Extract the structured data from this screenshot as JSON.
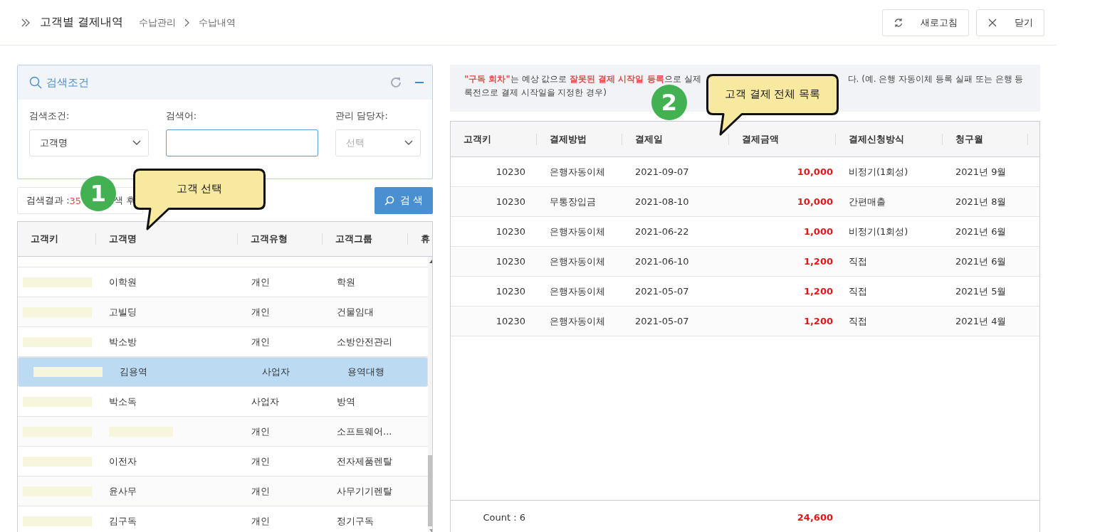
{
  "header": {
    "title": "고객별 결제내역",
    "breadcrumb": [
      "수납관리",
      "수납내역"
    ],
    "buttons": [
      {
        "label": "새로고침",
        "kind": "refresh"
      },
      {
        "label": "닫기",
        "kind": "close"
      }
    ]
  },
  "search_panel": {
    "title": "검색조건",
    "expanded": true,
    "fields": [
      {
        "label": "검색조건:",
        "kind": "select",
        "value": "고객명"
      },
      {
        "label": "검색어:",
        "kind": "input",
        "focused": true
      },
      {
        "label": "관리 담당자:",
        "kind": "select",
        "placeholder": "선택"
      }
    ]
  },
  "search_result": {
    "label": "검색결과 :",
    "count": "35",
    "tail": "색 후"
  },
  "search_button": "검 색",
  "customers": {
    "columns": [
      "고객키",
      "고객명",
      "고객유형",
      "고객그룹",
      "휴"
    ],
    "rows": [
      {
        "key_redacted": true,
        "name": "이학원",
        "type": "개인",
        "group": "학원",
        "selected": false
      },
      {
        "key_redacted": true,
        "name": "고빌딩",
        "type": "개인",
        "group": "건물임대",
        "selected": false
      },
      {
        "key_redacted": true,
        "name": "박소방",
        "type": "개인",
        "group": "소방안전관리",
        "selected": false
      },
      {
        "key_redacted": true,
        "name": "김용역",
        "type": "사업자",
        "group": "용역대행",
        "selected": true
      },
      {
        "key_redacted": true,
        "name": "박소독",
        "type": "사업자",
        "group": "방역",
        "selected": false
      },
      {
        "key_redacted": true,
        "name_redacted": true,
        "type": "개인",
        "group": "소프트웨어...",
        "selected": false
      },
      {
        "key_redacted": true,
        "name": "이전자",
        "type": "개인",
        "group": "전자제품렌탈",
        "selected": false
      },
      {
        "key_redacted": true,
        "name": "윤사무",
        "type": "개인",
        "group": "사무기기렌탈",
        "selected": false
      },
      {
        "key_redacted": true,
        "name": "김구독",
        "type": "개인",
        "group": "정기구독",
        "selected": false
      }
    ]
  },
  "notice": {
    "line1_start": "**\"구독 회차\"**는 예상 값으로 **잘못된 결제 시작일 등록**으로 실제",
    "line1_end": "다. (예. 은행 자동이체 등록 실패 또는 은행 등",
    "line2": "록전으로 결제 시작일을 지정한 경우)"
  },
  "payments": {
    "columns": [
      "고객키",
      "결제방법",
      "결제일",
      "결제금액",
      "결제신청방식",
      "청구월"
    ],
    "rows": [
      [
        "10230",
        "은행자동이체",
        "2021-09-07",
        "10,000",
        "비정기(1회성)",
        "2021년 9월"
      ],
      [
        "10230",
        "무통장입금",
        "2021-08-10",
        "10,000",
        "간편매출",
        "2021년 8월"
      ],
      [
        "10230",
        "은행자동이체",
        "2021-06-22",
        "1,000",
        "비정기(1회성)",
        "2021년 6월"
      ],
      [
        "10230",
        "은행자동이체",
        "2021-06-10",
        "1,200",
        "직접",
        "2021년 6월"
      ],
      [
        "10230",
        "은행자동이체",
        "2021-05-07",
        "1,200",
        "직접",
        "2021년 5월"
      ],
      [
        "10230",
        "은행자동이체",
        "2021-05-07",
        "1,200",
        "직접",
        "2021년 4월"
      ]
    ],
    "footer": {
      "count": "Count : 6",
      "total": "24,600"
    }
  },
  "callouts": [
    {
      "number": "1",
      "text": "고객 선택"
    },
    {
      "number": "2",
      "text": "고객 결제 전체 목록"
    }
  ]
}
